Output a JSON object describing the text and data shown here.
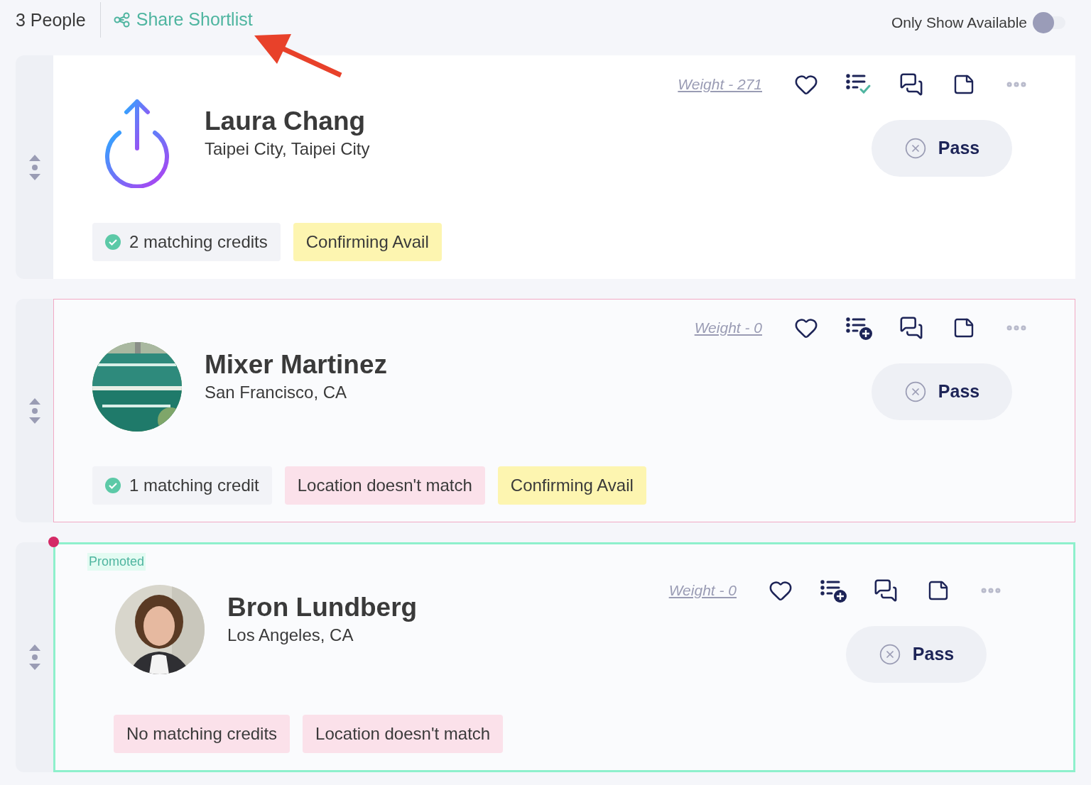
{
  "header": {
    "count": "3 People",
    "share_link": "Share Shortlist",
    "toggle": {
      "label": "Only Show Available",
      "on": false
    }
  },
  "candidates": [
    {
      "kind": "default",
      "name": "Laura Chang",
      "location": "Taipei City, Taipei City",
      "avatar": {
        "kind": "logo"
      },
      "weight": "Weight - 271",
      "shortlisted": true,
      "pass": "Pass",
      "tags": [
        {
          "kind": "match",
          "text": "2 matching credits"
        },
        {
          "kind": "pending",
          "text": "Confirming Avail"
        }
      ]
    },
    {
      "kind": "mismatch",
      "name": "Mixer Martinez",
      "location": "San Francisco, CA",
      "weight": "Weight - 0",
      "shortlisted": false,
      "pass": "Pass",
      "tags": [
        {
          "kind": "match",
          "text": "1 matching credit"
        },
        {
          "kind": "warning",
          "text": "Location doesn't match"
        },
        {
          "kind": "pending",
          "text": "Confirming Avail"
        }
      ]
    },
    {
      "kind": "promoted",
      "badge": "Promoted",
      "name": "Bron Lundberg",
      "location": "Los Angeles, CA",
      "avatar": {
        "kind": "portrait"
      },
      "weight": "Weight - 0",
      "shortlisted": false,
      "pass": "Pass",
      "tags": [
        {
          "kind": "warning",
          "text": "No matching credits"
        },
        {
          "kind": "warning",
          "text": "Location doesn't match"
        }
      ]
    }
  ]
}
